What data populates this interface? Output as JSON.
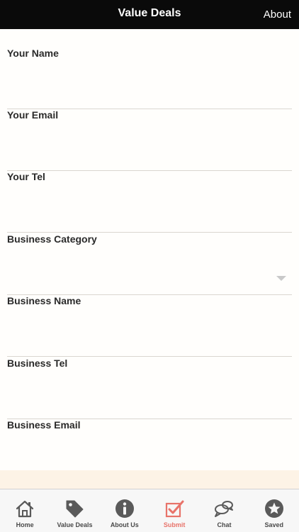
{
  "header": {
    "title": "Value Deals",
    "about_label": "About"
  },
  "form": {
    "fields": [
      {
        "label": "Your Name",
        "value": ""
      },
      {
        "label": "Your Email",
        "value": ""
      },
      {
        "label": "Your Tel",
        "value": ""
      },
      {
        "label": "Business Category",
        "value": ""
      },
      {
        "label": "Business Name",
        "value": ""
      },
      {
        "label": "Business Tel",
        "value": ""
      },
      {
        "label": "Business Email",
        "value": ""
      }
    ]
  },
  "tabbar": {
    "tabs": [
      {
        "label": "Home",
        "icon": "home-icon"
      },
      {
        "label": "Value Deals",
        "icon": "tag-icon"
      },
      {
        "label": "About Us",
        "icon": "info-icon"
      },
      {
        "label": "Submit",
        "icon": "checkbox-icon",
        "active": true
      },
      {
        "label": "Chat",
        "icon": "chat-bubbles-icon"
      },
      {
        "label": "Saved",
        "icon": "star-icon"
      }
    ]
  },
  "colors": {
    "header_bg": "#0a0a0a",
    "active_tab": "#e8736a",
    "icon_gray": "#5a5a5a"
  }
}
